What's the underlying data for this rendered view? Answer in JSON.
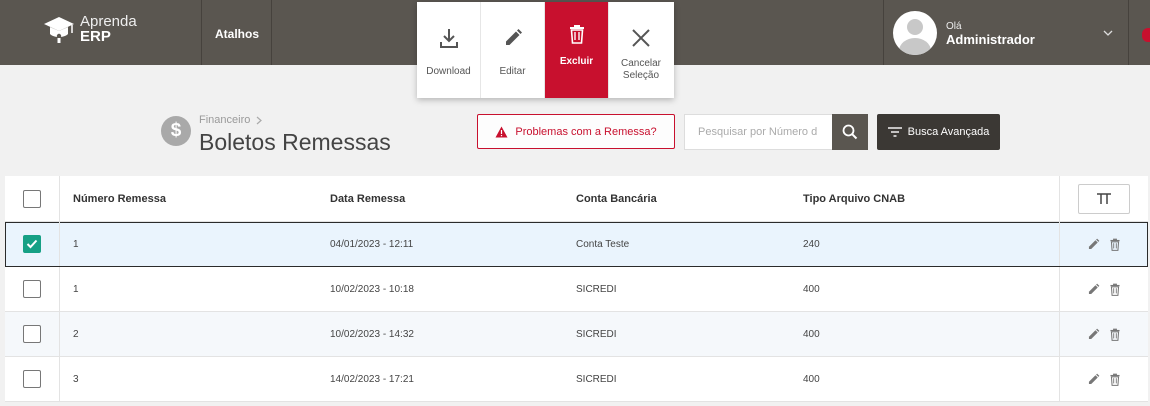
{
  "brand": {
    "line1": "Aprenda",
    "line2": "ERP"
  },
  "nav": {
    "atalhos": "Atalhos"
  },
  "user": {
    "greeting": "Olá",
    "name": "Administrador"
  },
  "actions": [
    {
      "label": "Download",
      "icon": "download-icon"
    },
    {
      "label": "Editar",
      "icon": "pencil-icon"
    },
    {
      "label": "Excluir",
      "icon": "trash-icon",
      "active": true
    },
    {
      "label": "Cancelar Seleção",
      "icon": "close-icon"
    }
  ],
  "breadcrumb": {
    "parent": "Financeiro"
  },
  "page": {
    "title": "Boletos Remessas",
    "icon_symbol": "$"
  },
  "problem_button": "Problemas com a Remessa?",
  "search": {
    "placeholder": "Pesquisar por Número d"
  },
  "advanced_search": "Busca Avançada",
  "table": {
    "columns": [
      "Número Remessa",
      "Data Remessa",
      "Conta Bancária",
      "Tipo Arquivo CNAB"
    ],
    "rows": [
      {
        "numero": "1",
        "data": "04/01/2023 - 12:11",
        "conta": "Conta Teste",
        "tipo": "240",
        "checked": true
      },
      {
        "numero": "1",
        "data": "10/02/2023 - 10:18",
        "conta": "SICREDI",
        "tipo": "400",
        "checked": false
      },
      {
        "numero": "2",
        "data": "10/02/2023 - 14:32",
        "conta": "SICREDI",
        "tipo": "400",
        "checked": false
      },
      {
        "numero": "3",
        "data": "14/02/2023 - 17:21",
        "conta": "SICREDI",
        "tipo": "400",
        "checked": false
      }
    ]
  },
  "colors": {
    "topbar": "#5a5650",
    "accent_red": "#c8102e",
    "check_green": "#16a085",
    "selected_row": "#eaf4fd"
  }
}
